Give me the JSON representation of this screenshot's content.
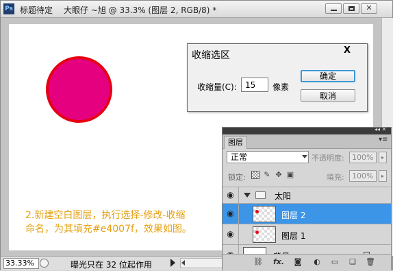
{
  "titlebar": {
    "app_icon": "Ps",
    "app_name": "标题待定",
    "doc_title": "大眼仔 ~旭 @ 33.3% (图层 2, RGB/8) *"
  },
  "canvas": {
    "circle_fill": "#e4007f",
    "circle_stroke": "#e60012",
    "caption": "2.新建空白图层，执行选择-修改-收缩\n 命名，为其填充#e4007f，效果如图。",
    "caption_color": "#e5a112"
  },
  "dialog": {
    "title": "收缩选区",
    "close": "X",
    "label": "收缩量(C):",
    "value": "15",
    "unit": "像素",
    "ok": "确定",
    "cancel": "取消"
  },
  "statusbar": {
    "zoom": "33.33%",
    "text": "曝光只在 32 位起作用"
  },
  "layers_panel": {
    "tab": "图层",
    "blend_mode": "正常",
    "opacity_label": "不透明度:",
    "opacity_value": "100%",
    "lock_label": "锁定:",
    "fill_label": "填充:",
    "fill_value": "100%",
    "selected_color": "#3d95e8",
    "group_name": "太阳",
    "layers": [
      {
        "name": "图层 2",
        "selected": true
      },
      {
        "name": "图层 1",
        "selected": false
      },
      {
        "name": "背景",
        "selected": false
      }
    ],
    "bottom_icons": [
      "link-icon",
      "fx-icon",
      "mask-icon",
      "adjustment-icon",
      "group-icon",
      "new-layer-icon",
      "trash-icon"
    ],
    "bottom_fx": "fx."
  }
}
